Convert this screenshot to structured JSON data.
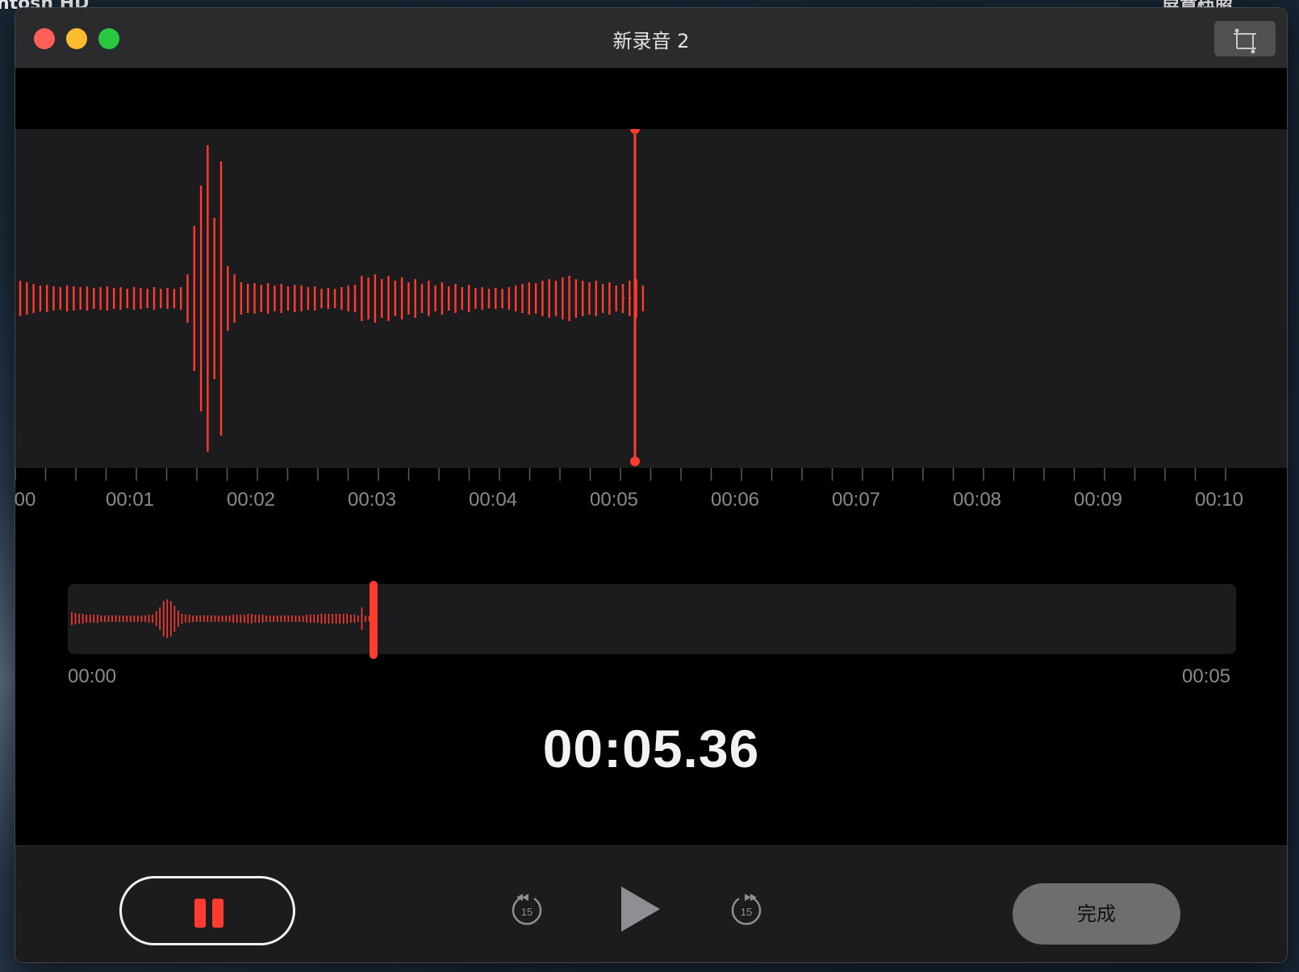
{
  "desktop": {
    "left_label": "ntosh HD",
    "right_label": "屏幕快照"
  },
  "window": {
    "title": "新录音 2"
  },
  "timeline": {
    "labels": [
      "00",
      "00:01",
      "00:02",
      "00:03",
      "00:04",
      "00:05",
      "00:06",
      "00:07",
      "00:08",
      "00:09",
      "00:10"
    ]
  },
  "overview": {
    "start_time": "00:00",
    "end_time": "00:05"
  },
  "elapsed": "00:05.36",
  "controls": {
    "skip_back_seconds": "15",
    "skip_forward_seconds": "15",
    "done_label": "完成"
  },
  "colors": {
    "accent": "#ff3b30",
    "panel": "#1c1c1e"
  },
  "icons": [
    "trim-icon",
    "pause-icon",
    "skip-back-15-icon",
    "play-icon",
    "skip-forward-15-icon"
  ]
}
